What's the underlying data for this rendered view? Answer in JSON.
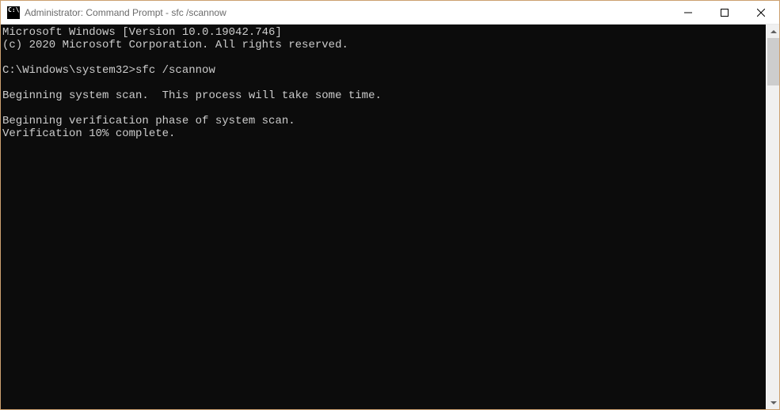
{
  "window": {
    "title": "Administrator: Command Prompt - sfc  /scannow",
    "icon_label": "C:\\"
  },
  "terminal": {
    "line_version": "Microsoft Windows [Version 10.0.19042.746]",
    "line_copyright": "(c) 2020 Microsoft Corporation. All rights reserved.",
    "blank1": "",
    "prompt_line": "C:\\Windows\\system32>sfc /scannow",
    "blank2": "",
    "scan_begin": "Beginning system scan.  This process will take some time.",
    "blank3": "",
    "verify_begin": "Beginning verification phase of system scan.",
    "verify_progress": "Verification 10% complete."
  }
}
